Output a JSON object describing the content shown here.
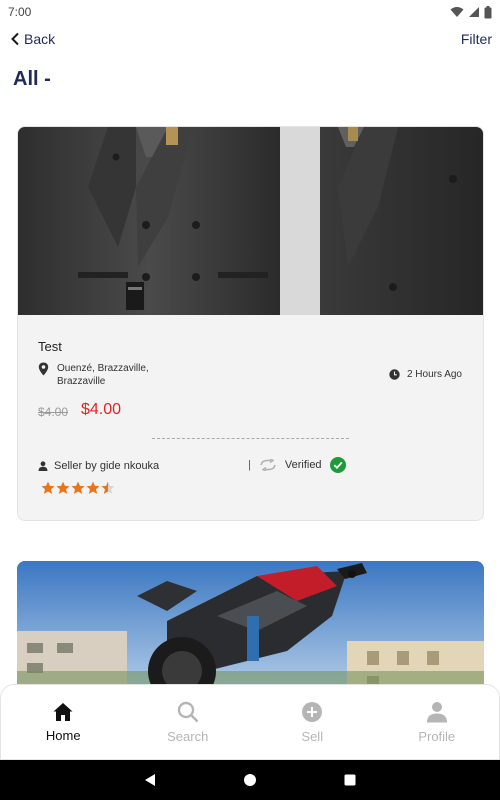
{
  "status_bar": {
    "time": "7:00"
  },
  "header": {
    "back_label": "Back",
    "filter_label": "Filter",
    "page_title": "All -"
  },
  "product": {
    "title": "Test",
    "location": "Ouenzé, Brazzaville, Brazzaville",
    "time_ago": "2 Hours Ago",
    "old_price": "$4.00",
    "price": "$4.00",
    "seller": "Seller by gide nkouka",
    "separator": "|",
    "verified_label": "Verified",
    "rating": 4.5,
    "rating_max": 5
  },
  "bottom_nav": {
    "items": [
      {
        "label": "Home",
        "icon": "home-icon",
        "active": true
      },
      {
        "label": "Search",
        "icon": "search-icon",
        "active": false
      },
      {
        "label": "Sell",
        "icon": "plus-circle-icon",
        "active": false
      },
      {
        "label": "Profile",
        "icon": "person-icon",
        "active": false
      }
    ]
  },
  "colors": {
    "accent": "#1f2a5c",
    "price": "#e02424",
    "star": "#e8751a",
    "verified": "#1e9a3a"
  }
}
